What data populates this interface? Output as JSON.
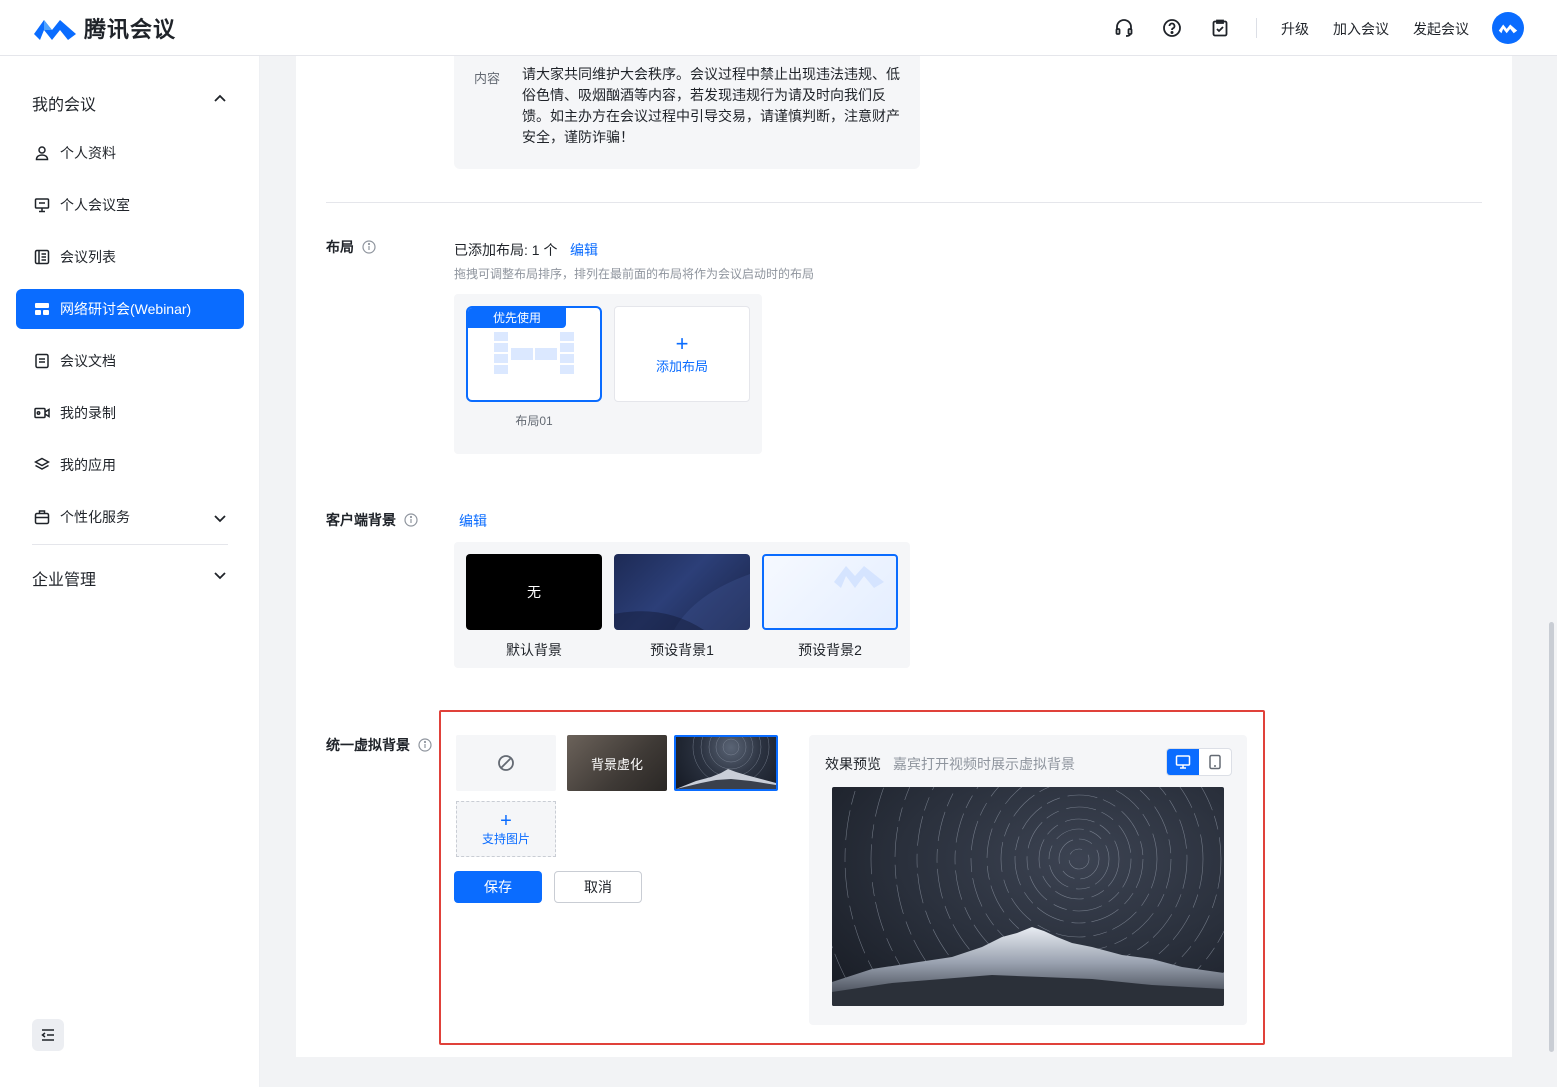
{
  "app": {
    "name": "腾讯会议"
  },
  "header": {
    "icons": [
      "headset-icon",
      "help-icon",
      "clipboard-icon"
    ],
    "links": {
      "upgrade": "升级",
      "join": "加入会议",
      "start": "发起会议"
    }
  },
  "sidebar": {
    "group_meetings": "我的会议",
    "items": [
      {
        "label": "个人资料",
        "icon": "user-icon"
      },
      {
        "label": "个人会议室",
        "icon": "monitor-icon"
      },
      {
        "label": "会议列表",
        "icon": "list-icon"
      },
      {
        "label": "网络研讨会(Webinar)",
        "icon": "webinar-icon",
        "active": true
      },
      {
        "label": "会议文档",
        "icon": "document-icon"
      },
      {
        "label": "我的录制",
        "icon": "video-icon"
      },
      {
        "label": "我的应用",
        "icon": "layers-icon"
      },
      {
        "label": "个性化服务",
        "icon": "briefcase-icon"
      }
    ],
    "group_enterprise": "企业管理"
  },
  "notice": {
    "label": "内容",
    "text": "请大家共同维护大会秩序。会议过程中禁止出现违法违规、低俗色情、吸烟酗酒等内容，若发现违规行为请及时向我们反馈。如主办方在会议过程中引导交易，请谨慎判断，注意财产安全，谨防诈骗！"
  },
  "layout": {
    "label": "布局",
    "count_text": "已添加布局: 1 个",
    "edit": "编辑",
    "hint": "拖拽可调整布局排序，排列在最前面的布局将作为会议启动时的布局",
    "card_tag": "优先使用",
    "card_name": "布局01",
    "add_label": "添加布局"
  },
  "client_bg": {
    "label": "客户端背景",
    "edit": "编辑",
    "options": [
      {
        "name": "默认背景",
        "thumb_text": "无"
      },
      {
        "name": "预设背景1",
        "thumb_text": ""
      },
      {
        "name": "预设背景2",
        "thumb_text": ""
      }
    ]
  },
  "virtual_bg": {
    "label": "统一虚拟背景",
    "blur_label": "背景虚化",
    "upload_label": "支持图片",
    "save": "保存",
    "cancel": "取消",
    "preview_title": "效果预览",
    "preview_sub": "嘉宾打开视频时展示虚拟背景"
  },
  "colors": {
    "accent": "#0a6cff",
    "highlight": "#e0413a"
  }
}
